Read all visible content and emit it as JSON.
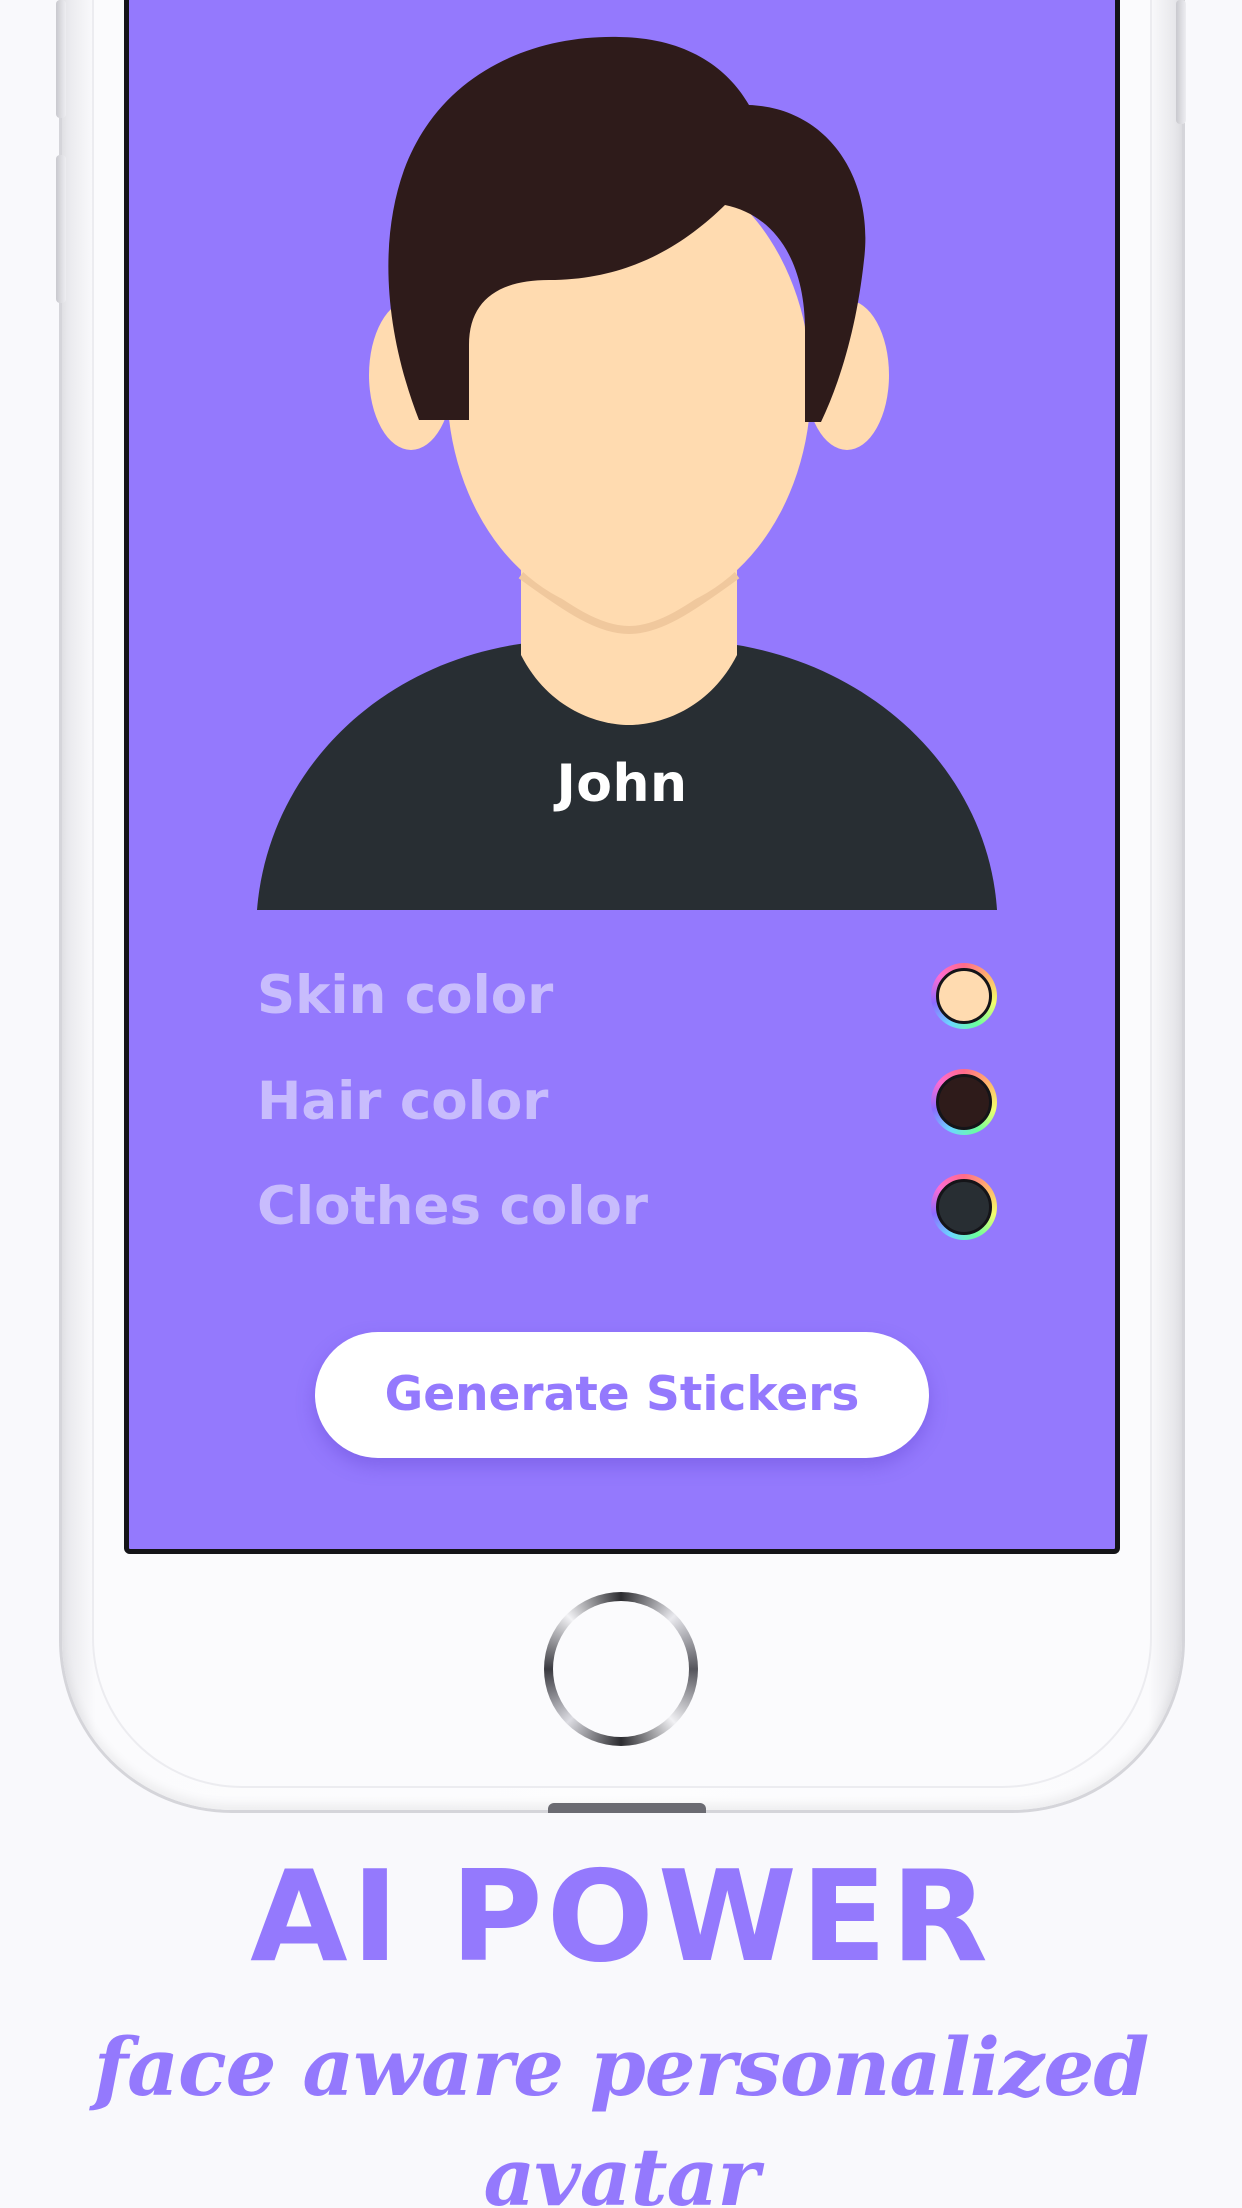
{
  "colors": {
    "accent": "#9479fd",
    "skin": "#ffdbb0",
    "hair": "#2e1b1a",
    "clothes": "#282e33",
    "label": "#c8bcfd"
  },
  "avatar": {
    "name": "John"
  },
  "customization": {
    "rows": [
      {
        "label": "Skin color",
        "color": "#ffdbb0"
      },
      {
        "label": "Hair color",
        "color": "#2e1b1a"
      },
      {
        "label": "Clothes color",
        "color": "#282e33"
      }
    ]
  },
  "actions": {
    "generate_label": "Generate Stickers"
  },
  "promo": {
    "headline": "AI POWER",
    "tagline": "face aware personalized avatar"
  }
}
